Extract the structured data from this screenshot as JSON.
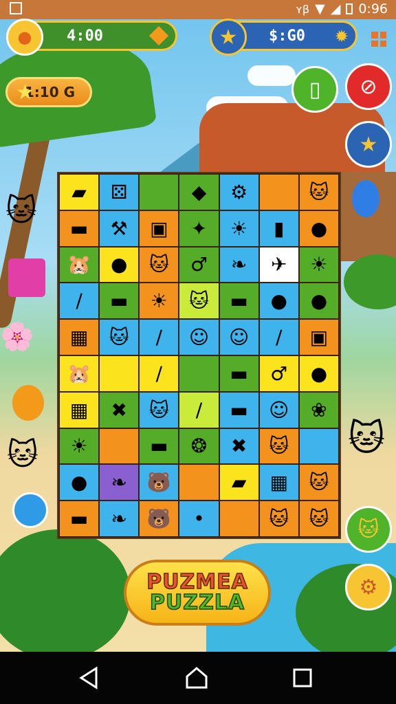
{
  "status_bar": {
    "signal_text": "ʏβ",
    "time": "0:96"
  },
  "hud": {
    "timer": "4:00",
    "coins": "$:G0",
    "level": "1:10 G"
  },
  "logo": {
    "line1": "PUZMEA",
    "line2": "PUZZLA"
  },
  "colors": {
    "yellow": "#fbe41e",
    "blue": "#3fb4ec",
    "green": "#55ac28",
    "orange": "#f3931d",
    "purple": "#8a5fcf",
    "white": "#ffffff",
    "lime": "#c9ec3a"
  },
  "board": {
    "rows": [
      [
        {
          "c": "yellow",
          "i": "eraser-icon",
          "g": "▰"
        },
        {
          "c": "blue",
          "i": "dice-icon",
          "g": "⚄"
        },
        {
          "c": "green",
          "i": "",
          "g": ""
        },
        {
          "c": "green",
          "i": "block-icon",
          "g": "◆"
        },
        {
          "c": "blue",
          "i": "scroll-icon",
          "g": "⚙"
        },
        {
          "c": "orange",
          "i": "",
          "g": ""
        },
        {
          "c": "orange",
          "i": "cat-face-icon",
          "g": "🐱"
        }
      ],
      [
        {
          "c": "orange",
          "i": "log-icon",
          "g": "▬"
        },
        {
          "c": "blue",
          "i": "wrench-icon",
          "g": "⚒"
        },
        {
          "c": "orange",
          "i": "toy-car-icon",
          "g": "▣"
        },
        {
          "c": "green",
          "i": "flashlight-icon",
          "g": "✦"
        },
        {
          "c": "blue",
          "i": "sun-icon",
          "g": "☀"
        },
        {
          "c": "blue",
          "i": "tube-icon",
          "g": "▮"
        },
        {
          "c": "orange",
          "i": "candy-icon",
          "g": "●"
        }
      ],
      [
        {
          "c": "green",
          "i": "hamster-icon",
          "g": "🐹"
        },
        {
          "c": "yellow",
          "i": "candy-icon",
          "g": "●"
        },
        {
          "c": "orange",
          "i": "cat-face-icon",
          "g": "🐱"
        },
        {
          "c": "green",
          "i": "lollipop-icon",
          "g": "♂"
        },
        {
          "c": "blue",
          "i": "corn-icon",
          "g": "❧"
        },
        {
          "c": "white",
          "i": "rocket-icon",
          "g": "✈"
        },
        {
          "c": "green",
          "i": "chick-icon",
          "g": "☀"
        }
      ],
      [
        {
          "c": "blue",
          "i": "stick-icon",
          "g": "∕"
        },
        {
          "c": "green",
          "i": "log-icon",
          "g": "▬"
        },
        {
          "c": "orange",
          "i": "sun-icon",
          "g": "☀"
        },
        {
          "c": "lime",
          "i": "cat-face-icon",
          "g": "🐱"
        },
        {
          "c": "green",
          "i": "log-icon",
          "g": "▬"
        },
        {
          "c": "blue",
          "i": "balloon-icon",
          "g": "●"
        },
        {
          "c": "green",
          "i": "blob-icon",
          "g": "●"
        }
      ],
      [
        {
          "c": "orange",
          "i": "crate-icon",
          "g": "▦"
        },
        {
          "c": "blue",
          "i": "cat-face-icon",
          "g": "🐱"
        },
        {
          "c": "blue",
          "i": "pen-icon",
          "g": "∕"
        },
        {
          "c": "blue",
          "i": "glasses-face-icon",
          "g": "☺"
        },
        {
          "c": "blue",
          "i": "glasses-face-icon",
          "g": "☺"
        },
        {
          "c": "blue",
          "i": "pen-icon",
          "g": "∕"
        },
        {
          "c": "orange",
          "i": "cube-icon",
          "g": "▣"
        }
      ],
      [
        {
          "c": "yellow",
          "i": "hamster-icon",
          "g": "🐹"
        },
        {
          "c": "yellow",
          "i": "",
          "g": ""
        },
        {
          "c": "yellow",
          "i": "stick-icon",
          "g": "∕"
        },
        {
          "c": "green",
          "i": "",
          "g": ""
        },
        {
          "c": "green",
          "i": "log-icon",
          "g": "▬"
        },
        {
          "c": "yellow",
          "i": "lollipop-icon",
          "g": "♂"
        },
        {
          "c": "yellow",
          "i": "cherry-icon",
          "g": "●"
        }
      ],
      [
        {
          "c": "yellow",
          "i": "crate-icon",
          "g": "▦"
        },
        {
          "c": "green",
          "i": "slingshot-icon",
          "g": "✖"
        },
        {
          "c": "blue",
          "i": "cat-face-icon",
          "g": "🐱"
        },
        {
          "c": "lime",
          "i": "pencil-icon",
          "g": "∕"
        },
        {
          "c": "blue",
          "i": "boat-icon",
          "g": "▬"
        },
        {
          "c": "blue",
          "i": "seal-icon",
          "g": "☺"
        },
        {
          "c": "green",
          "i": "candy-icon",
          "g": "❀"
        }
      ],
      [
        {
          "c": "green",
          "i": "chick-icon",
          "g": "☀"
        },
        {
          "c": "orange",
          "i": "",
          "g": ""
        },
        {
          "c": "green",
          "i": "boat-icon",
          "g": "▬"
        },
        {
          "c": "green",
          "i": "bone-icon",
          "g": "❂"
        },
        {
          "c": "blue",
          "i": "cross-sticks-icon",
          "g": "✖"
        },
        {
          "c": "orange",
          "i": "cat-face-icon",
          "g": "🐱"
        },
        {
          "c": "blue",
          "i": "",
          "g": ""
        }
      ],
      [
        {
          "c": "blue",
          "i": "purple-blob-icon",
          "g": "●"
        },
        {
          "c": "purple",
          "i": "pinecone-icon",
          "g": "❧"
        },
        {
          "c": "blue",
          "i": "bear-icon",
          "g": "🐻"
        },
        {
          "c": "orange",
          "i": "",
          "g": ""
        },
        {
          "c": "yellow",
          "i": "eraser-icon",
          "g": "▰"
        },
        {
          "c": "blue",
          "i": "crate-icon",
          "g": "▦"
        },
        {
          "c": "orange",
          "i": "cat-face-icon",
          "g": "🐱"
        }
      ],
      [
        {
          "c": "orange",
          "i": "boat-icon",
          "g": "▬"
        },
        {
          "c": "blue",
          "i": "corn-icon",
          "g": "❧"
        },
        {
          "c": "orange",
          "i": "bear-icon",
          "g": "🐻"
        },
        {
          "c": "blue",
          "i": "berries-icon",
          "g": "•"
        },
        {
          "c": "orange",
          "i": "",
          "g": ""
        },
        {
          "c": "orange",
          "i": "cat-face-icon",
          "g": "🐱"
        },
        {
          "c": "orange",
          "i": "green-cat-icon",
          "g": "🐱"
        }
      ]
    ]
  }
}
